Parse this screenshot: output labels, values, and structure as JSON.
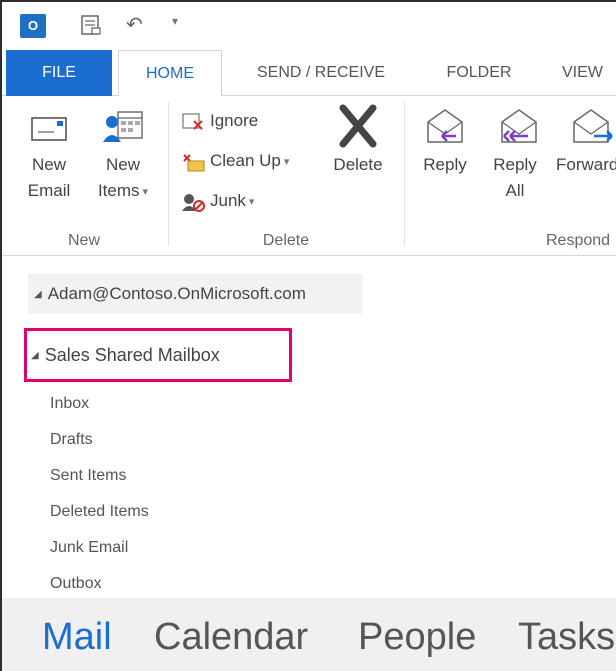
{
  "qat": {
    "app_icon_text": "O",
    "undo_glyph": "↶",
    "customize_glyph": "▾"
  },
  "tabs": [
    "FILE",
    "HOME",
    "SEND / RECEIVE",
    "FOLDER",
    "VIEW"
  ],
  "ribbon": {
    "groups": {
      "new": {
        "label": "New",
        "new_email": [
          "New",
          "Email"
        ],
        "new_items": [
          "New",
          "Items"
        ]
      },
      "delete": {
        "label": "Delete",
        "ignore": "Ignore",
        "clean_up": "Clean Up",
        "junk": "Junk",
        "delete": "Delete"
      },
      "respond": {
        "label": "Respond",
        "reply": "Reply",
        "reply_all": [
          "Reply",
          "All"
        ],
        "forward": "Forward"
      }
    }
  },
  "folder_pane": {
    "account": "Adam@Contoso.OnMicrosoft.com",
    "shared_mailbox": "Sales Shared Mailbox",
    "folders": [
      "Inbox",
      "Drafts",
      "Sent Items",
      "Deleted Items",
      "Junk Email",
      "Outbox"
    ],
    "highlight_color": "#e3006f"
  },
  "navbar": {
    "items": [
      "Mail",
      "Calendar",
      "People",
      "Tasks"
    ],
    "active": "Mail",
    "accent": "#1c6dd0"
  }
}
